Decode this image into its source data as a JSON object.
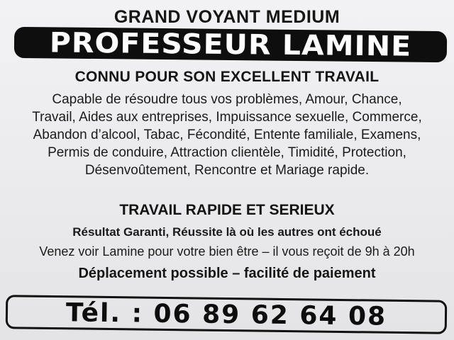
{
  "flyer": {
    "top_title": "GRAND VOYANT MEDIUM",
    "name_banner": "PROFESSEUR LAMINE",
    "headline": "CONNU POUR SON EXCELLENT TRAVAIL",
    "services_lines": [
      "Capable de résoudre tous vos problèmes, Amour, Chance,",
      "Travail, Aides aux entreprises, Impuissance sexuelle, Commerce,",
      "Abandon d’alcool, Tabac, Fécondité, Entente familiale, Examens,",
      "Permis de conduire, Attraction clientèle, Timidité, Protection,",
      "Désenvoûtement, Rencontre et Mariage rapide."
    ],
    "subheadline": "TRAVAIL RAPIDE ET SERIEUX",
    "guarantee": "Résultat Garanti, Réussite là où les autres ont échoué",
    "visit": "Venez voir Lamine pour votre bien être – il vous reçoit de 9h à 20h",
    "travel": "Déplacement possible – facilité de paiement",
    "phone": "Tél. : 06 89 62 64 08"
  }
}
